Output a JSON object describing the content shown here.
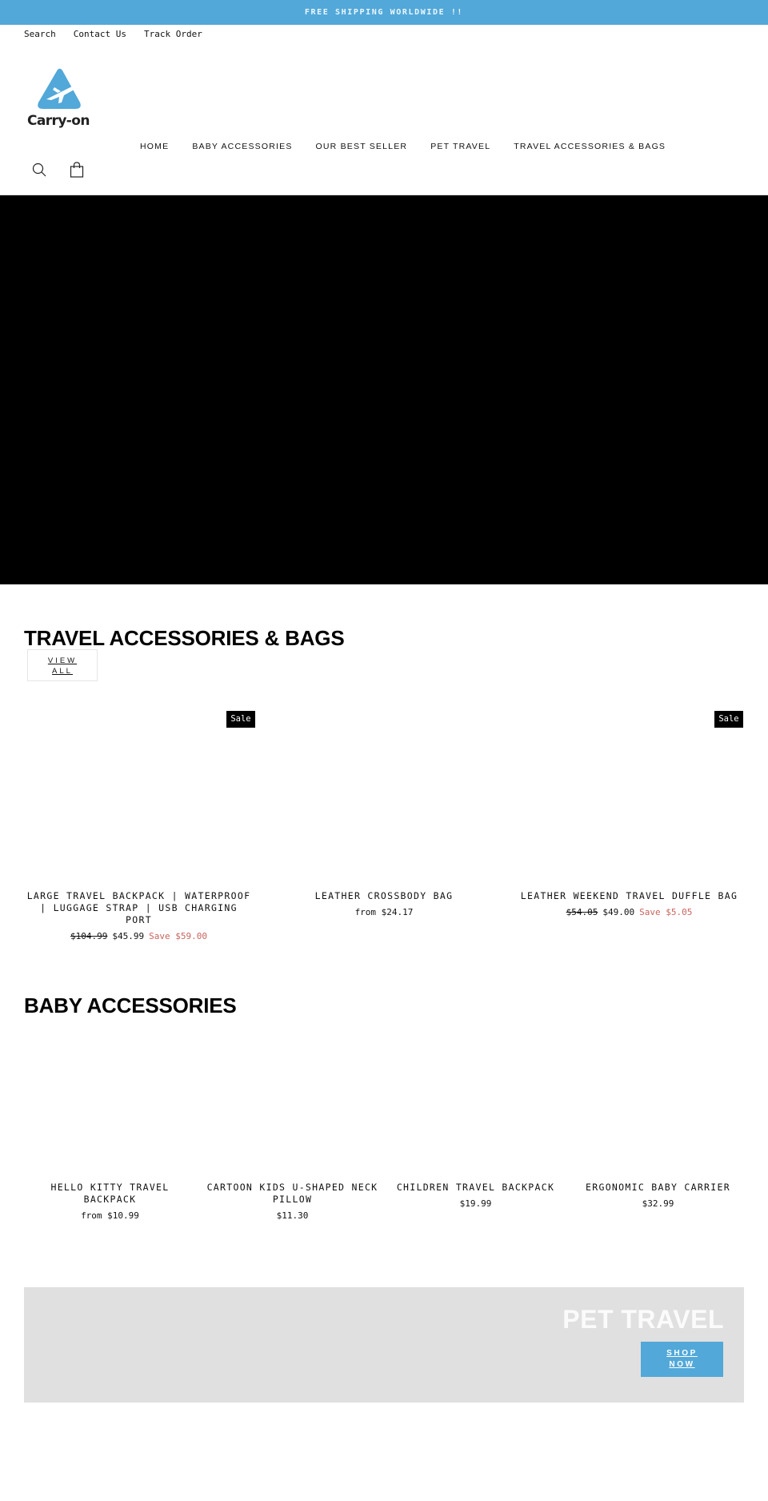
{
  "announcement": "FREE SHIPPING WORLDWIDE !!",
  "utility_nav": [
    "Search",
    "Contact Us",
    "Track Order"
  ],
  "brand": {
    "name": "Carry-on",
    "accent": "#52a8d8"
  },
  "main_nav": [
    "HOME",
    "BABY ACCESSORIES",
    "OUR BEST SELLER",
    "PET TRAVEL",
    "TRAVEL ACCESSORIES & BAGS"
  ],
  "header_icons": {
    "search": "search-icon",
    "cart": "cart-icon"
  },
  "travel_section": {
    "title": "TRAVEL ACCESSORIES & BAGS",
    "view_all_line1": "VIEW",
    "view_all_line2": "ALL",
    "products": [
      {
        "name": "LARGE TRAVEL BACKPACK | WATERPROOF | LUGGAGE STRAP | USB CHARGING PORT",
        "badge": "Sale",
        "original_price": "$104.99",
        "price": "$45.99",
        "save": "Save $59.00"
      },
      {
        "name": "LEATHER CROSSBODY BAG",
        "price": "from $24.17"
      },
      {
        "name": "LEATHER WEEKEND TRAVEL DUFFLE BAG",
        "badge": "Sale",
        "original_price": "$54.05",
        "price": "$49.00",
        "save": "Save $5.05"
      }
    ]
  },
  "baby_section": {
    "title": "BABY ACCESSORIES",
    "products": [
      {
        "name": "HELLO KITTY TRAVEL BACKPACK",
        "price": "from $10.99"
      },
      {
        "name": "CARTOON KIDS U-SHAPED NECK PILLOW",
        "price": "$11.30"
      },
      {
        "name": "CHILDREN TRAVEL BACKPACK",
        "price": "$19.99"
      },
      {
        "name": "ERGONOMIC BABY CARRIER",
        "price": "$32.99"
      }
    ]
  },
  "pet_banner": {
    "title": "PET TRAVEL",
    "button_line1": "SHOP",
    "button_line2": "NOW"
  }
}
